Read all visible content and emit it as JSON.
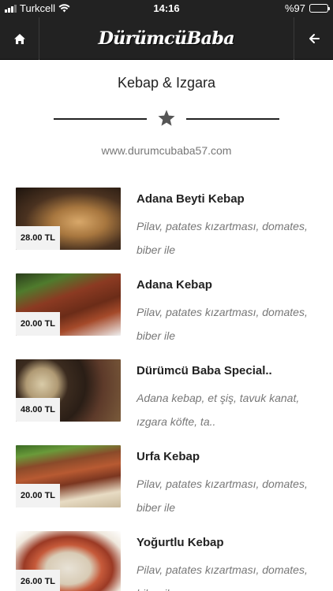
{
  "status_bar": {
    "carrier": "Turkcell",
    "time": "14:16",
    "battery_text": "%97",
    "battery_level": 0.97
  },
  "navbar": {
    "logo_text": "DürümcüBaba"
  },
  "header": {
    "title": "Kebap & Izgara",
    "website": "www.durumcubaba57.com"
  },
  "items": [
    {
      "name": "Adana Beyti Kebap",
      "description": "Pilav, patates kızartması, domates, biber ile",
      "price": "28.00 TL"
    },
    {
      "name": "Adana Kebap",
      "description": "Pilav, patates kızartması, domates, biber ile",
      "price": "20.00 TL"
    },
    {
      "name": "Dürümcü Baba Special..",
      "description": "Adana kebap, et şiş, tavuk kanat, ızgara köfte, ta..",
      "price": "48.00 TL"
    },
    {
      "name": "Urfa Kebap",
      "description": "Pilav, patates kızartması, domates, biber ile",
      "price": "20.00 TL"
    },
    {
      "name": "Yoğurtlu Kebap",
      "description": "Pilav, patates kızartması, domates, biber ile",
      "price": "26.00 TL"
    }
  ],
  "colors": {
    "bar": "#222222",
    "accent": "#222222",
    "muted_text": "#777777",
    "star": "#555555"
  },
  "icons": {
    "home": "home-icon",
    "back": "arrow-left-icon",
    "divider": "star-icon"
  }
}
